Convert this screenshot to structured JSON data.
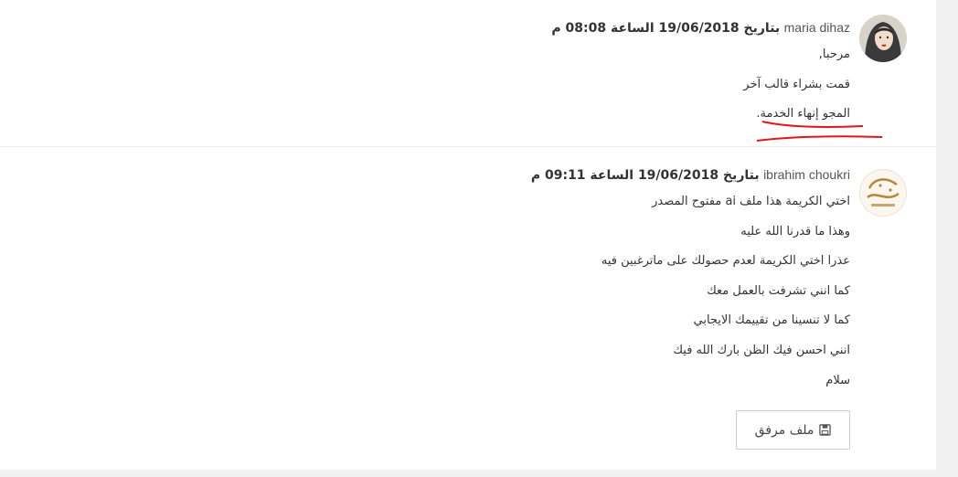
{
  "messages": [
    {
      "author": "maria dihaz",
      "meta": "بتاريخ 19/06/2018 الساعة 08:08 م",
      "lines": [
        "مرحبا,",
        "قمت بشراء قالب آخر",
        "المجو إنهاء الخدمة."
      ],
      "avatar": "avatar-woman-hijab"
    },
    {
      "author": "ibrahim choukri",
      "meta": "بتاريخ 19/06/2018 الساعة 09:11 م",
      "lines": [
        "اختي الكريمة هذا ملف ai مفتوح المصدر",
        "وهذا ما قدرنا الله عليه",
        "عذرا اختي الكريمة لعدم حصولك على ماترغبين فيه",
        "كما انني تشرفت بالعمل معك",
        "كما لا تنسينا من تقييمك الايجابي",
        "انني احسن فيك الظن بارك الله فيك",
        "سلام"
      ],
      "avatar": "avatar-calligraphy-logo",
      "attachment_label": "ملف مرفق",
      "attachment_icon": "floppy-disk-icon"
    }
  ],
  "colors": {
    "annotation": "#e0161b",
    "border": "#ececec",
    "gutter": "#f1f1f1"
  }
}
